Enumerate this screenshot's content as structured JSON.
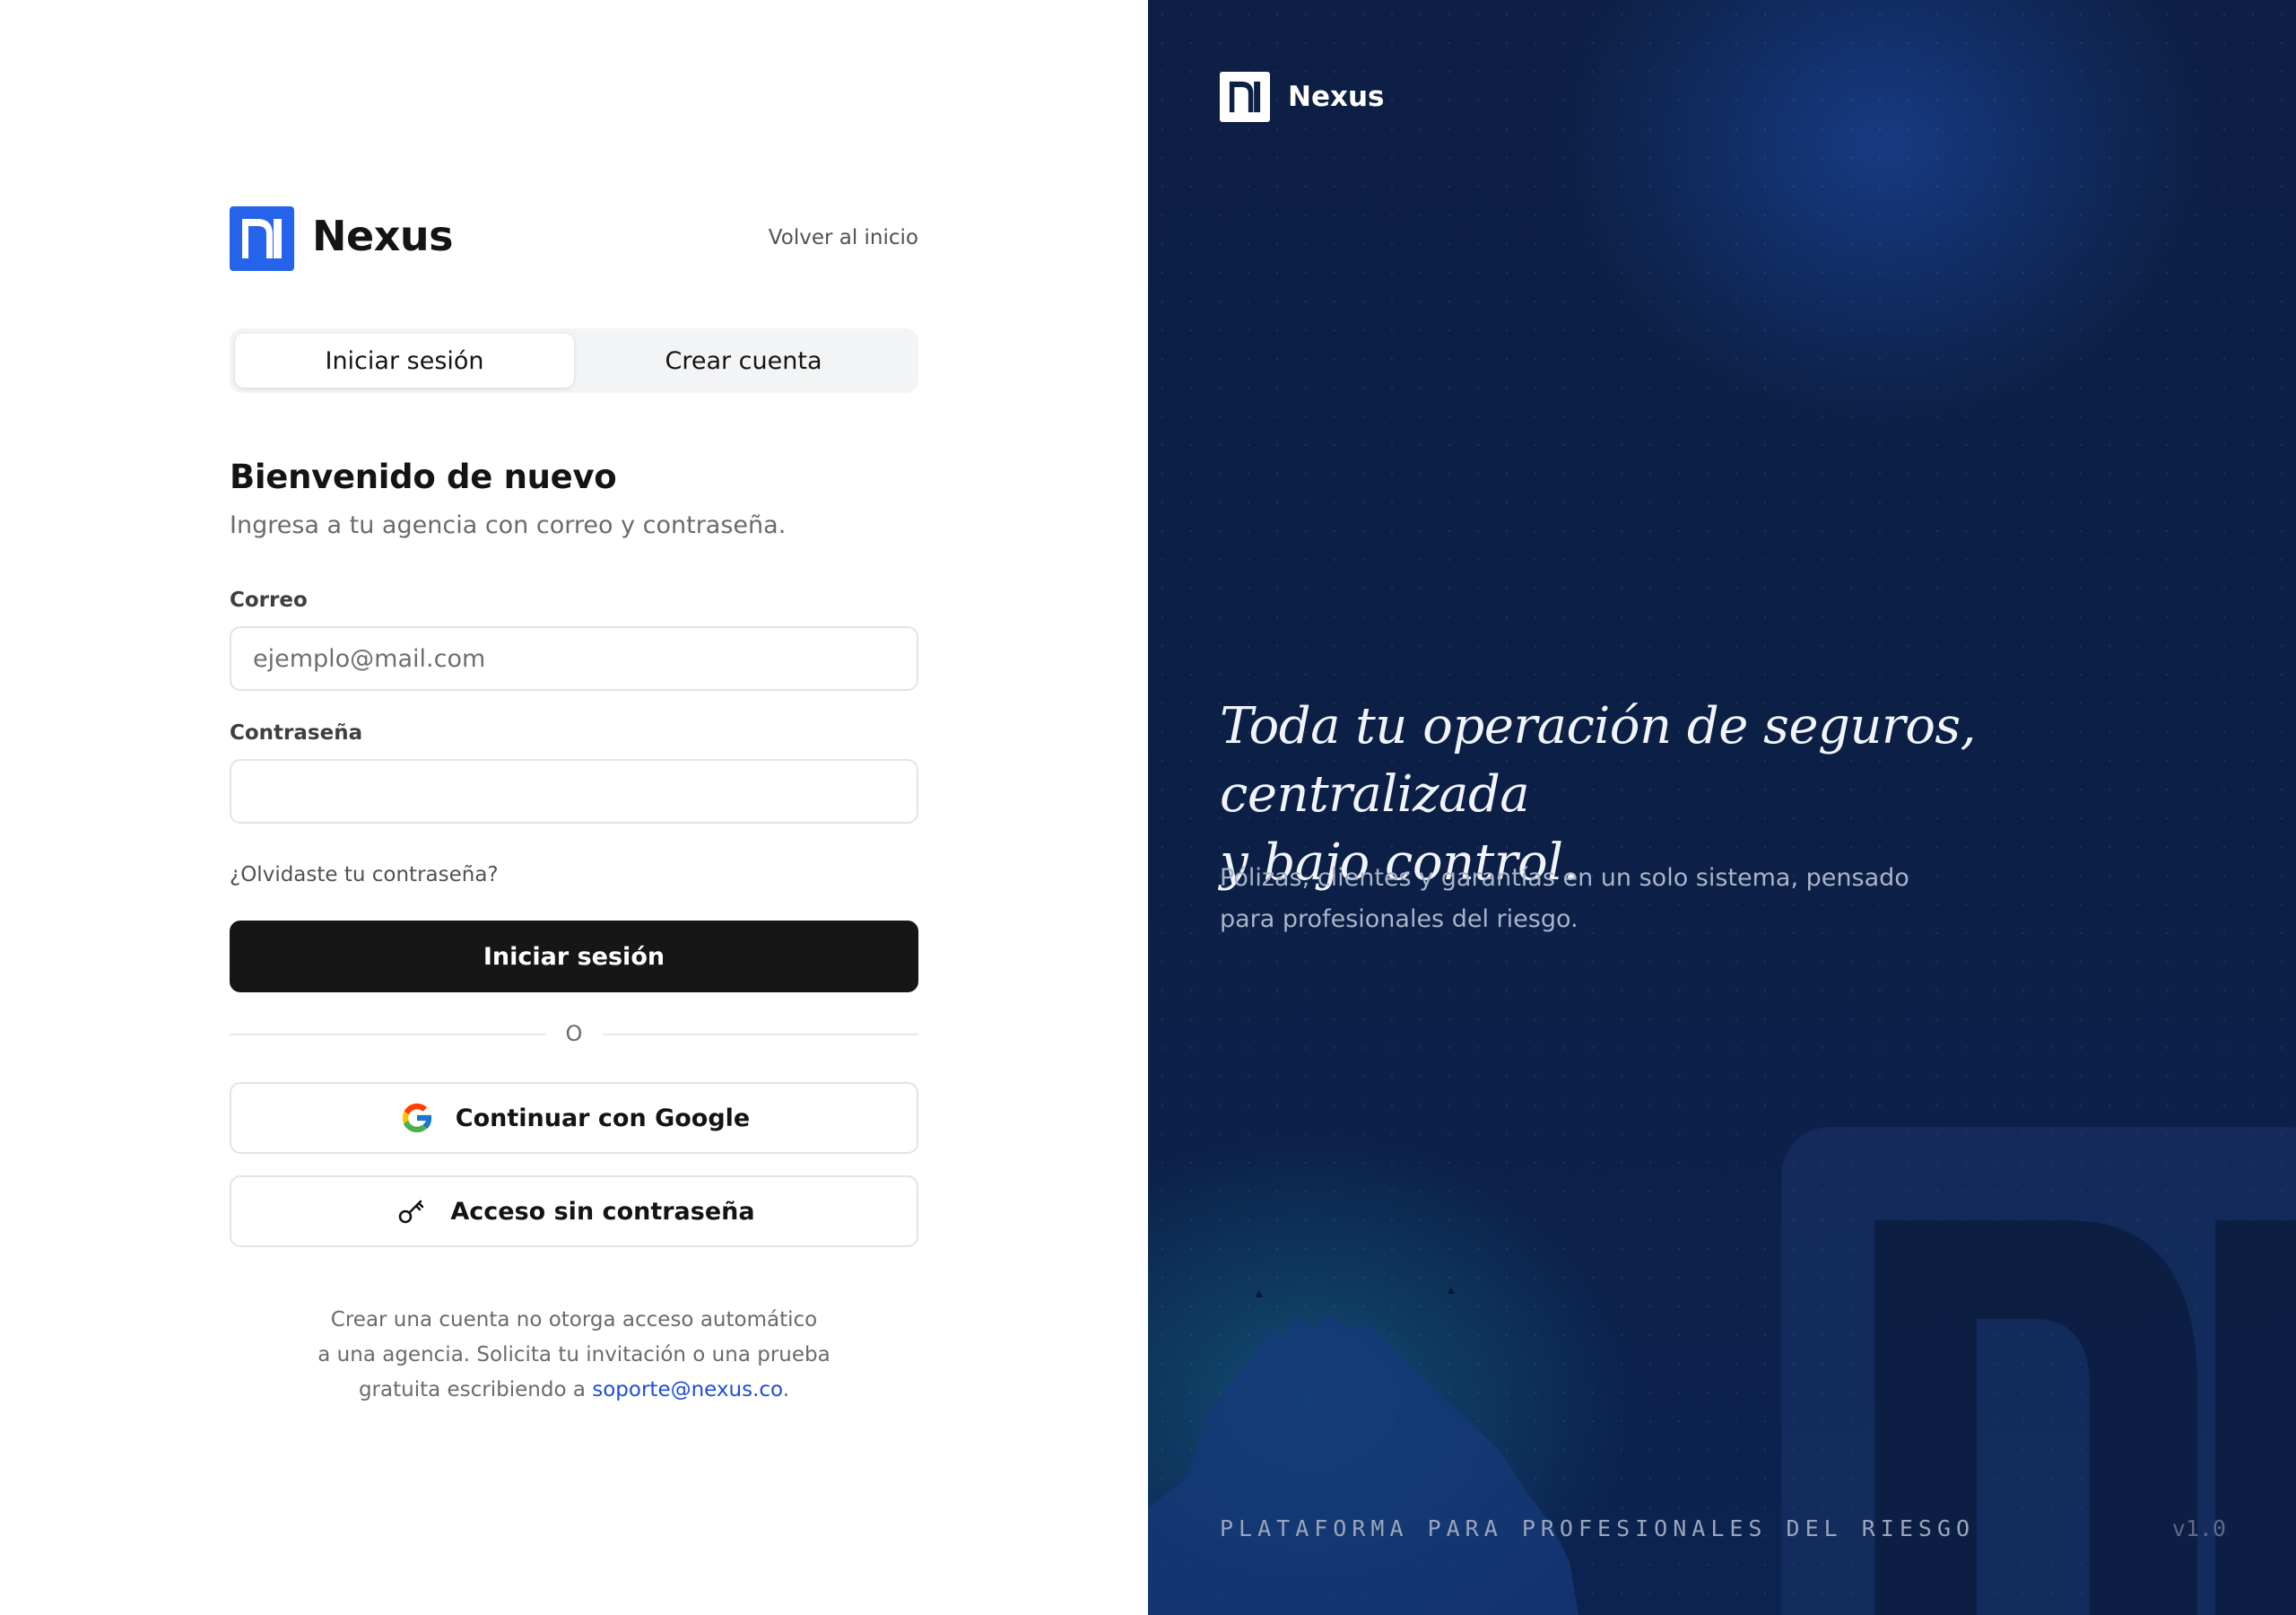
{
  "brand": {
    "name": "Nexus"
  },
  "nav": {
    "back_label": "Volver al inicio"
  },
  "tabs": [
    {
      "label": "Iniciar sesión",
      "active": true
    },
    {
      "label": "Crear cuenta",
      "active": false
    }
  ],
  "form": {
    "heading": "Bienvenido de nuevo",
    "subheading": "Ingresa a tu agencia con correo y contraseña.",
    "email": {
      "label": "Correo",
      "placeholder": "ejemplo@mail.com",
      "value": ""
    },
    "password": {
      "label": "Contraseña",
      "placeholder": "",
      "value": ""
    },
    "forgot_label": "¿Olvidaste tu contraseña?",
    "submit_label": "Iniciar sesión",
    "divider_label": "O",
    "google_label": "Continuar con Google",
    "passwordless_label": "Acceso sin contraseña",
    "footnote": {
      "line1": "Crear una cuenta no otorga acceso automático",
      "line2": "a una agencia. Solicita tu invitación o una prueba",
      "line3_prefix": "gratuita escribiendo a ",
      "email": "soporte@nexus.co",
      "line3_suffix": "."
    }
  },
  "hero": {
    "brand_name": "Nexus",
    "tagline_line1": "Toda tu operación de seguros, centralizada",
    "tagline_line2": "y bajo control.",
    "description_line1": "Pólizas, clientes y garantías en un solo sistema, pensado",
    "description_line2": "para profesionales del riesgo.",
    "footer_label": "PLATAFORMA PARA PROFESIONALES DEL RIESGO",
    "version": "v1.0"
  },
  "icons": {
    "logo": "nexus-logo-icon",
    "google": "google-icon",
    "passkey": "key-icon"
  },
  "colors": {
    "brand_blue": "#2563eb",
    "primary_button": "#161616",
    "link": "#1d4ed8",
    "hero_background": "#0c1f45"
  }
}
